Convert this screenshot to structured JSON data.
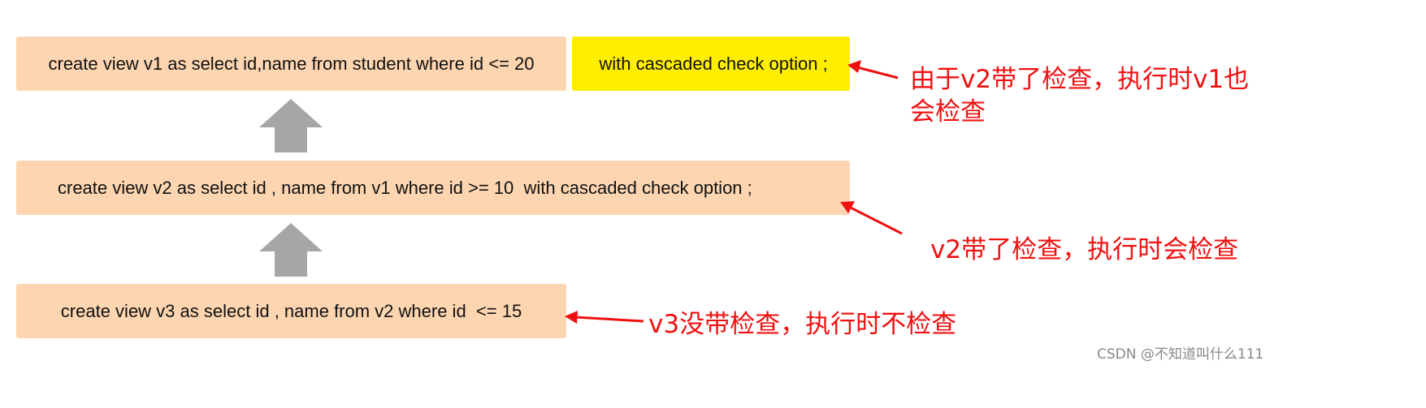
{
  "views": [
    {
      "sql": "create view v1 as select id,name from student where id <= 20",
      "highlight": " with cascaded check option ;"
    },
    {
      "sql": "create view v2 as select id , name from v1 where id >= 10  with cascaded check option ;"
    },
    {
      "sql": "create view v3 as select id , name from v2 where id  <= 15"
    }
  ],
  "notes": {
    "v1_line1": "由于v2带了检查，执行时v1也",
    "v1_line2": "会检查",
    "v2": "v2带了检查，执行时会检查",
    "v3": "v3没带检查，执行时不检查"
  },
  "watermark": "CSDN @不知道叫什么111",
  "colors": {
    "box": "#fdd5b1",
    "highlight": "#ffee00",
    "annotation": "#f01010",
    "arrow": "#a6a6a6"
  }
}
